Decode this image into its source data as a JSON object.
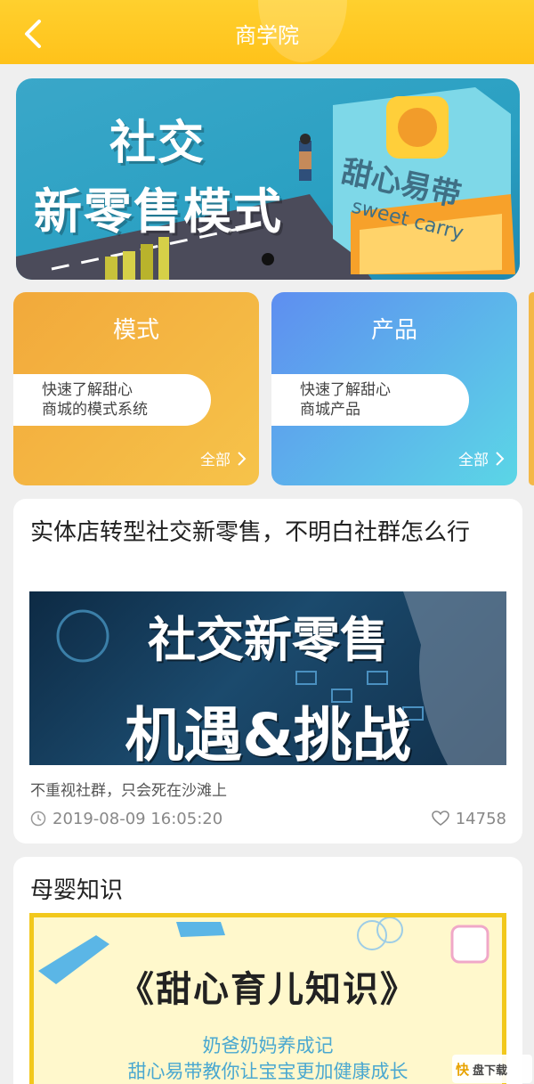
{
  "header": {
    "title": "商学院"
  },
  "banner": {
    "title_line1": "社交",
    "title_line2": "新零售模式",
    "brand_cn": "甜心易带",
    "brand_en": "sweet carry"
  },
  "categories": [
    {
      "name": "模式",
      "desc_line1": "快速了解甜心",
      "desc_line2": "商城的模式系统",
      "all": "全部"
    },
    {
      "name": "产品",
      "desc_line1": "快速了解甜心",
      "desc_line2": "商城产品",
      "all": "全部"
    }
  ],
  "articles": [
    {
      "title": "实体店转型社交新零售，不明白社群怎么行",
      "image_line1": "社交新零售",
      "image_line2": "机遇&挑战",
      "desc": "不重视社群，只会死在沙滩上",
      "time": "2019-08-09 16:05:20",
      "likes": "14758"
    },
    {
      "title": "母婴知识",
      "image_title": "《甜心育儿知识》",
      "image_sub1": "奶爸奶妈养成记",
      "image_sub2": "甜心易带教你让宝宝更加健康成长"
    }
  ],
  "watermark": {
    "logo": "快",
    "text": "盘下载"
  }
}
